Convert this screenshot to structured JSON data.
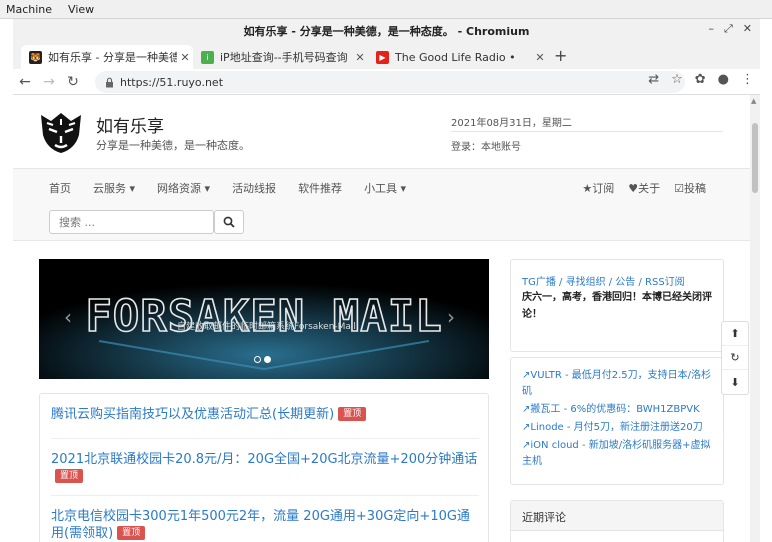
{
  "os_menu": [
    "Machine",
    "View"
  ],
  "window": {
    "title": "如有乐享 - 分享是一种美德，是一种态度。 - Chromium",
    "controls": [
      "–",
      "⤢",
      "✕"
    ]
  },
  "tabs": [
    {
      "label": "如有乐享 - 分享是一种美德",
      "favicon": "tiger-favicon",
      "favicon_color": "#222222",
      "active": true
    },
    {
      "label": "iP地址查询--手机号码查询",
      "favicon": "ip-favicon",
      "favicon_color": "#4caf50",
      "active": false
    },
    {
      "label": "The Good Life Radio •",
      "favicon": "youtube-favicon",
      "favicon_color": "#e62117",
      "active": false
    }
  ],
  "toolbar": {
    "url": "https://51.ruyo.net",
    "icons": [
      "translate-icon",
      "star-icon",
      "extension-icon",
      "account-icon",
      "menu-icon"
    ]
  },
  "site": {
    "name": "如有乐享",
    "slogan": "分享是一种美德，是一种态度。",
    "date": "2021年08月31日，星期二",
    "login": "登录：本地账号"
  },
  "nav": {
    "items": [
      "首页",
      "云服务 ▾",
      "网络资源 ▾",
      "活动线报",
      "软件推荐",
      "小工具 ▾"
    ],
    "right": [
      "★订阅",
      "♥关于",
      "☑投稿"
    ],
    "search_placeholder": "搜索 ..."
  },
  "carousel": {
    "title_art": "FORSAKEN MAIL",
    "caption": "自建收取邮件的临时邮箱系统Forsaken-Mail",
    "prev": "‹",
    "next": "›"
  },
  "posts": [
    {
      "title": "腾讯云购买指南技巧以及优惠活动汇总(长期更新)",
      "badge": "置顶"
    },
    {
      "title": "2021北京联通校园卡20.8元/月：20G全国+20G北京流量+200分钟通话",
      "badge": "置顶"
    },
    {
      "title": "北京电信校园卡300元1年500元2年，流量 20G通用+30G定向+10G通用(需领取)",
      "badge": "置顶"
    }
  ],
  "sidebar": {
    "links_line": "TG广播 / 寻找组织 / 公告 / RSS订阅",
    "notice": "庆六一，高考，香港回归！本博已经关闭评论！",
    "promos": [
      "VULTR - 最低月付2.5刀，支持日本/洛杉矶",
      "搬瓦工 - 6%的优惠码：BWH1ZBPVK",
      "Linode - 月付5刀，新注册注册送20刀",
      "iON cloud - 新加坡/洛杉矶服务器+虚拟主机"
    ],
    "recent_comments": "近期评论"
  },
  "float_tools": [
    "up-icon",
    "refresh-icon",
    "down-icon"
  ],
  "colors": {
    "link": "#2a7ac8",
    "badge": "#d9534f"
  }
}
